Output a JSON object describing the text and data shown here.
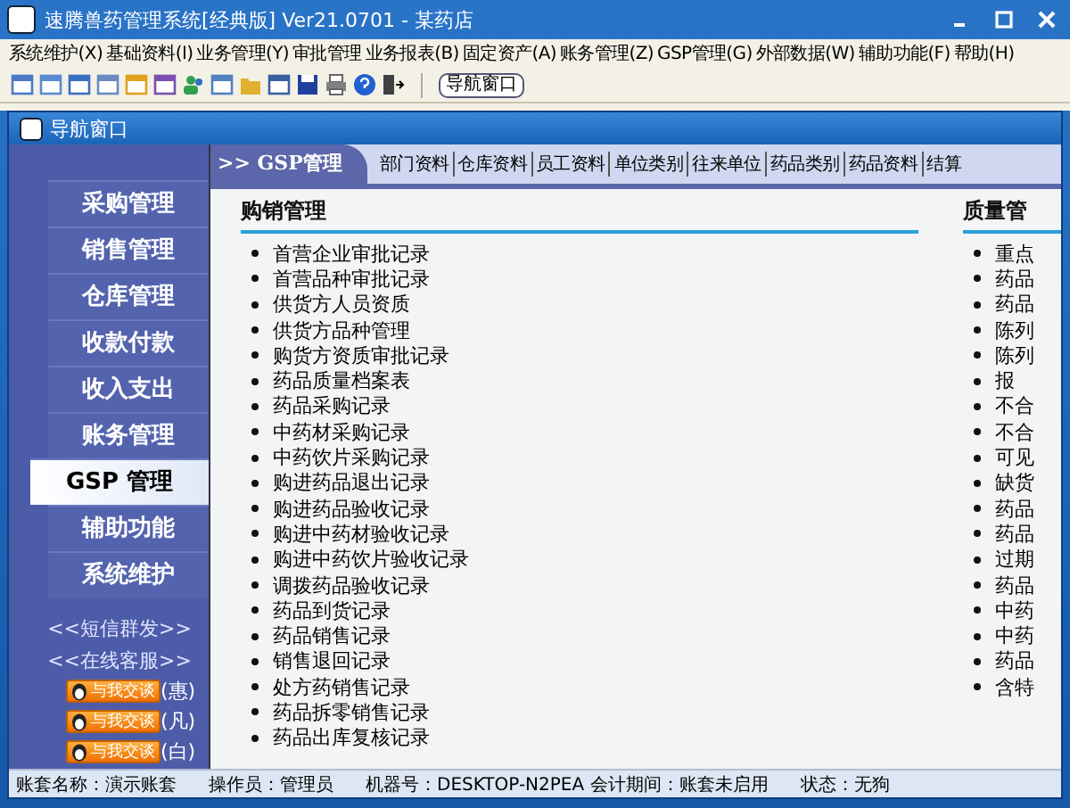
{
  "window": {
    "title": "速腾兽药管理系统[经典版] Ver21.0701  -  某药店"
  },
  "menu": [
    "系统维护(X)",
    "基础资料(I)",
    "业务管理(Y)",
    "审批管理",
    "业务报表(B)",
    "固定资产(A)",
    "账务管理(Z)",
    "GSP管理(G)",
    "外部数据(W)",
    "辅助功能(F)",
    "帮助(H)"
  ],
  "toolbar": {
    "button": "导航窗口"
  },
  "nav_window": {
    "title": "导航窗口"
  },
  "sidebar": {
    "items": [
      {
        "label": "采购管理",
        "selected": false
      },
      {
        "label": "销售管理",
        "selected": false
      },
      {
        "label": "仓库管理",
        "selected": false
      },
      {
        "label": "收款付款",
        "selected": false
      },
      {
        "label": "收入支出",
        "selected": false
      },
      {
        "label": "账务管理",
        "selected": false
      },
      {
        "label": "GSP 管理",
        "selected": true
      },
      {
        "label": "辅助功能",
        "selected": false
      },
      {
        "label": "系统维护",
        "selected": false
      }
    ],
    "links": [
      "<<短信群发>>",
      "<<在线客服>>"
    ],
    "chat": [
      {
        "button": "与我交谈",
        "name": "(惠)"
      },
      {
        "button": "与我交谈",
        "name": "(凡)"
      },
      {
        "button": "与我交谈",
        "name": "(白)"
      }
    ]
  },
  "tab_bar": {
    "tab": ">> GSP管理",
    "links": [
      "部门资料",
      "仓库资料",
      "员工资料",
      "单位类别",
      "往来单位",
      "药品类别",
      "药品资料",
      "结算"
    ]
  },
  "sections": [
    {
      "title": "购销管理",
      "items": [
        "首营企业审批记录",
        "首营品种审批记录",
        "供货方人员资质",
        "供货方品种管理",
        "购货方资质审批记录",
        "药品质量档案表",
        "药品采购记录",
        "中药材采购记录",
        "中药饮片采购记录",
        "购进药品退出记录",
        "购进药品验收记录",
        "购进中药材验收记录",
        "购进中药饮片验收记录",
        "调拨药品验收记录",
        "药品到货记录",
        "药品销售记录",
        "销售退回记录",
        "处方药销售记录",
        "药品拆零销售记录",
        "药品出库复核记录"
      ]
    },
    {
      "title": "质量管",
      "items": [
        "重点",
        "药品",
        "药品",
        "陈列",
        "陈列",
        "报",
        "不合",
        "不合",
        "可见",
        "缺货",
        "药品",
        "药品",
        "过期",
        "药品",
        "中药",
        "中药",
        "药品",
        "含特"
      ]
    }
  ],
  "status_bar": [
    "账套名称：演示账套",
    "操作员：管理员",
    "机器号：DESKTOP-N2PEA 会计期间：账套未启用",
    "状态：无狗"
  ]
}
